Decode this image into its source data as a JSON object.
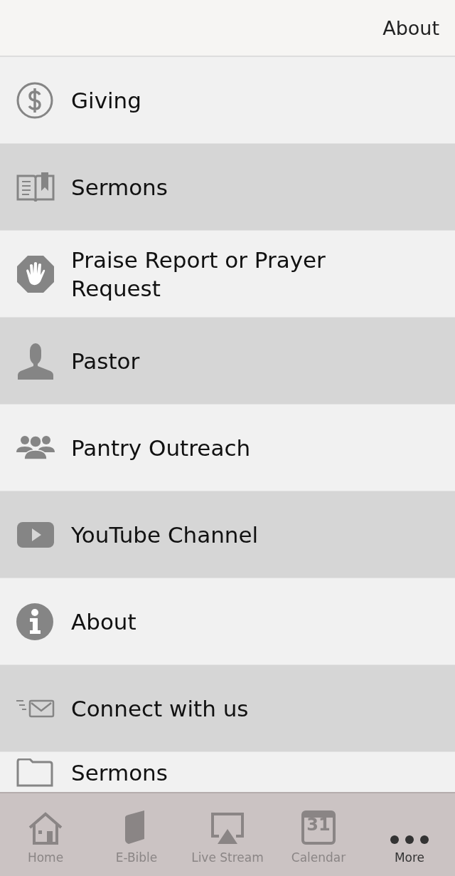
{
  "header": {
    "link": "About"
  },
  "menu": [
    {
      "label": "Giving"
    },
    {
      "label": "Sermons"
    },
    {
      "label": "Praise Report or Prayer Request"
    },
    {
      "label": "Pastor"
    },
    {
      "label": "Pantry Outreach"
    },
    {
      "label": "YouTube Channel"
    },
    {
      "label": "About"
    },
    {
      "label": "Connect with us"
    },
    {
      "label": "Sermons"
    }
  ],
  "tab_bar": [
    {
      "label": "Home",
      "selected": false
    },
    {
      "label": "E-Bible",
      "selected": false
    },
    {
      "label": "Live Stream",
      "selected": false
    },
    {
      "label": "Calendar",
      "selected": false,
      "icon_text": "31"
    },
    {
      "label": "More",
      "selected": true
    }
  ]
}
